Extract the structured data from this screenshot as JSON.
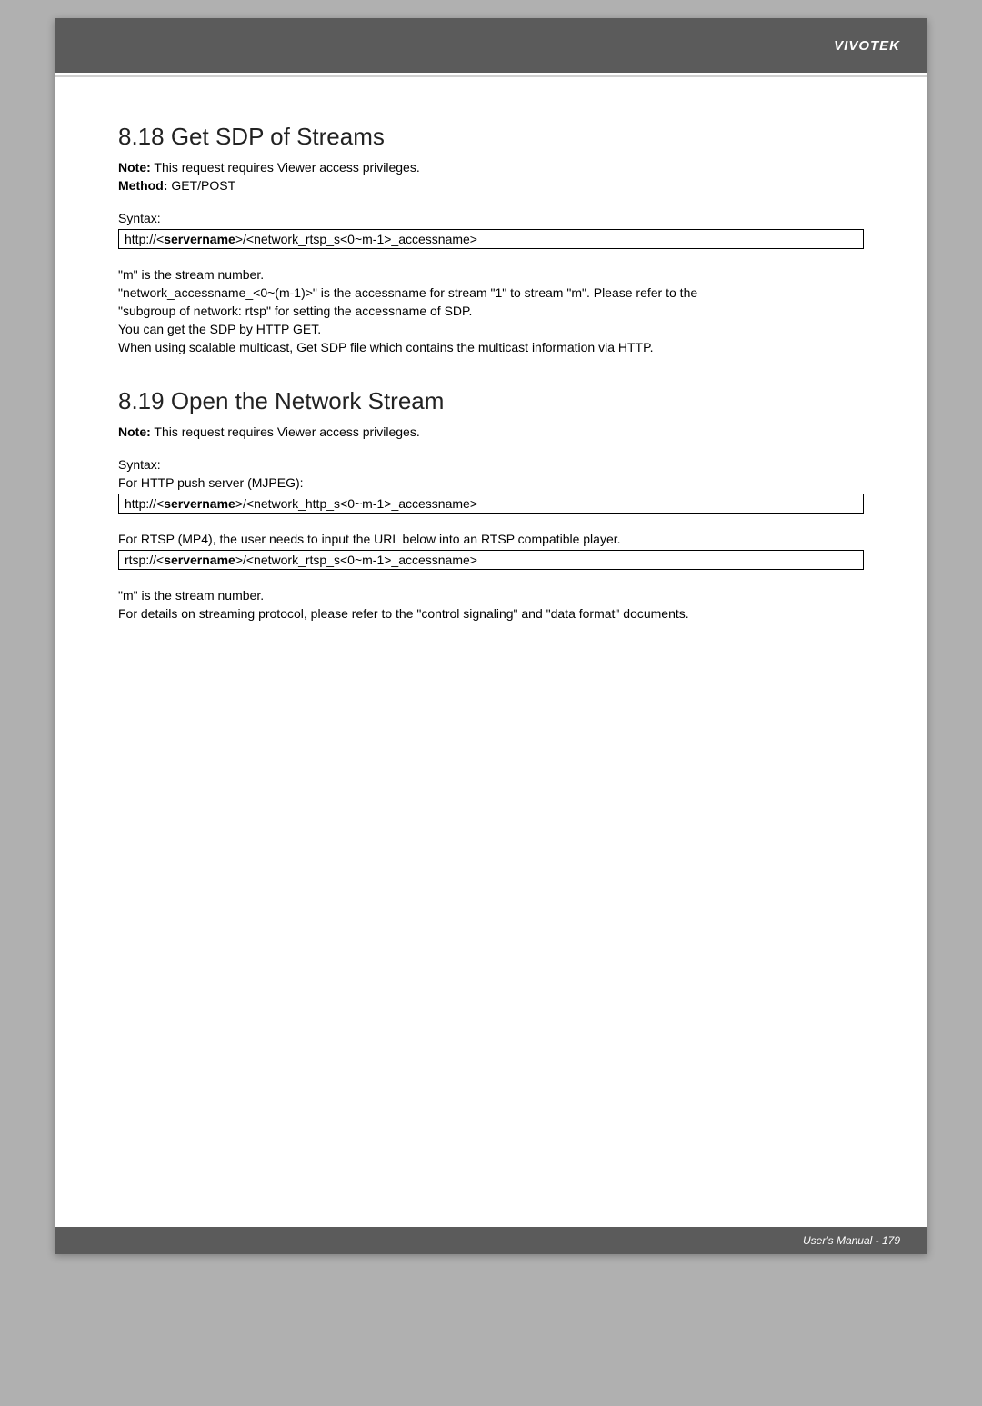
{
  "header": {
    "brand": "VIVOTEK"
  },
  "section1": {
    "title": "8.18 Get SDP of Streams",
    "note_label": "Note:",
    "note_text": "This request requires Viewer access privileges.",
    "method_label": "Method:",
    "method_text": "GET/POST",
    "syntax_label": "Syntax:",
    "syntax_code_prefix": "http://<",
    "syntax_code_server": "servername",
    "syntax_code_suffix": ">/<network_rtsp_s<0~m-1>_accessname>",
    "p1": "\"m\" is the stream number.",
    "p2": "\"network_accessname_<0~(m-1)>\" is the accessname for stream \"1\" to stream \"m\". Please refer to the",
    "p3": "\"subgroup of network: rtsp\" for setting the accessname of SDP.",
    "p4": "You can get the SDP by HTTP GET.",
    "p5": "When using scalable multicast, Get SDP file which contains the multicast information via HTTP."
  },
  "section2": {
    "title": "8.19 Open the Network Stream",
    "note_label": "Note:",
    "note_text": "This request requires Viewer access privileges.",
    "syntax_label": "Syntax:",
    "http_line": "For HTTP push server (MJPEG):",
    "http_code_prefix": "http://<",
    "http_code_server": "servername",
    "http_code_suffix": ">/<network_http_s<0~m-1>_accessname>",
    "rtsp_line": "For RTSP (MP4), the user needs to input the URL below into an RTSP compatible player.",
    "rtsp_code_prefix": "rtsp://<",
    "rtsp_code_server": "servername",
    "rtsp_code_suffix": ">/<network_rtsp_s<0~m-1>_accessname>",
    "p1": "\"m\" is the stream number.",
    "p2": "For details on streaming protocol, please refer to the \"control signaling\" and \"data format\" documents."
  },
  "footer": {
    "text": "User's Manual - 179"
  }
}
